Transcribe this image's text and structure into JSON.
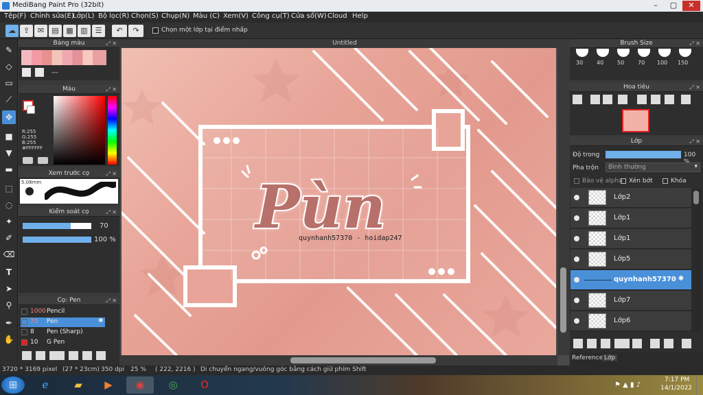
{
  "window": {
    "title": "MediBang Paint Pro (32bit)"
  },
  "menu": [
    "Tệp(F)",
    "Chỉnh sửa(E)",
    "Lớp(L)",
    "Bộ lọc(R)",
    "Chọn(S)",
    "Chụp(N)",
    "Màu (C)",
    "Xem(V)",
    "Công cụ(T)",
    "Cửa sổ(W)",
    "Cloud",
    "Help"
  ],
  "toolbar": {
    "select_checkbox_label": "Chọn một lớp tại điểm nhấp"
  },
  "panels": {
    "palette": {
      "title": "Bảng màu",
      "dashes": "---"
    },
    "color": {
      "title": "Màu",
      "r": "R:255",
      "g": "G:255",
      "b": "B:255",
      "hex": "#FFFFFF"
    },
    "brush_preview": {
      "title": "Xem trước cọ",
      "size": "5.08mm"
    },
    "brush_control": {
      "title": "Kiểm soát cọ",
      "size_value": "70",
      "opacity_value": "100 %",
      "size_level": 0.7,
      "opacity_level": 1.0
    },
    "brushes": {
      "title": "Cọ: Pen",
      "items": [
        {
          "size": "1000",
          "name": "Pencil",
          "color": "#2b2b2b"
        },
        {
          "size": "70",
          "name": "Pen",
          "color": "#2b2b2b"
        },
        {
          "size": "8",
          "name": "Pen (Sharp)",
          "color": "#2b2b2b"
        },
        {
          "size": "10",
          "name": "G Pen",
          "color": "#e02020"
        }
      ]
    },
    "brush_size": {
      "title": "Brush Size",
      "sizes": [
        "30",
        "40",
        "50",
        "70",
        "100",
        "150"
      ]
    },
    "navigator": {
      "title": "Hoa tiêu"
    },
    "layers": {
      "title": "Lớp",
      "opacity_label": "Độ trong",
      "opacity_value": "100 %",
      "blend_label": "Pha trộn",
      "blend_value": "Bình thường",
      "protect_alpha": "Bảo vệ alpha",
      "clipping": "Xén bớt",
      "lock": "Khóa",
      "items": [
        "Lớp2",
        "Lớp1",
        "Lớp1",
        "Lớp5",
        "quynhanh57370",
        "Lớp7",
        "Lớp6"
      ],
      "tabs": [
        "Reference",
        "Lớp"
      ]
    }
  },
  "document": {
    "tab": "Untitled",
    "artwork_title": "Pùn",
    "artwork_subtitle": "quynhanh57370    -    hoidap247"
  },
  "status": {
    "pixels": "3720 * 3169 pixel",
    "cm": "(27 * 23cm)",
    "dpi": "350 dpi",
    "zoom": "25 %",
    "coords": "( 222, 2216 )",
    "hint": "Di chuyển ngang/vuông góc bằng cách giữ phím Shift"
  },
  "taskbar": {
    "time": "7:17 PM",
    "date": "14/1/2022"
  },
  "colors": {
    "accent": "#4a90d9",
    "panel": "#2e2e2e",
    "artboard": "#e8a498"
  }
}
